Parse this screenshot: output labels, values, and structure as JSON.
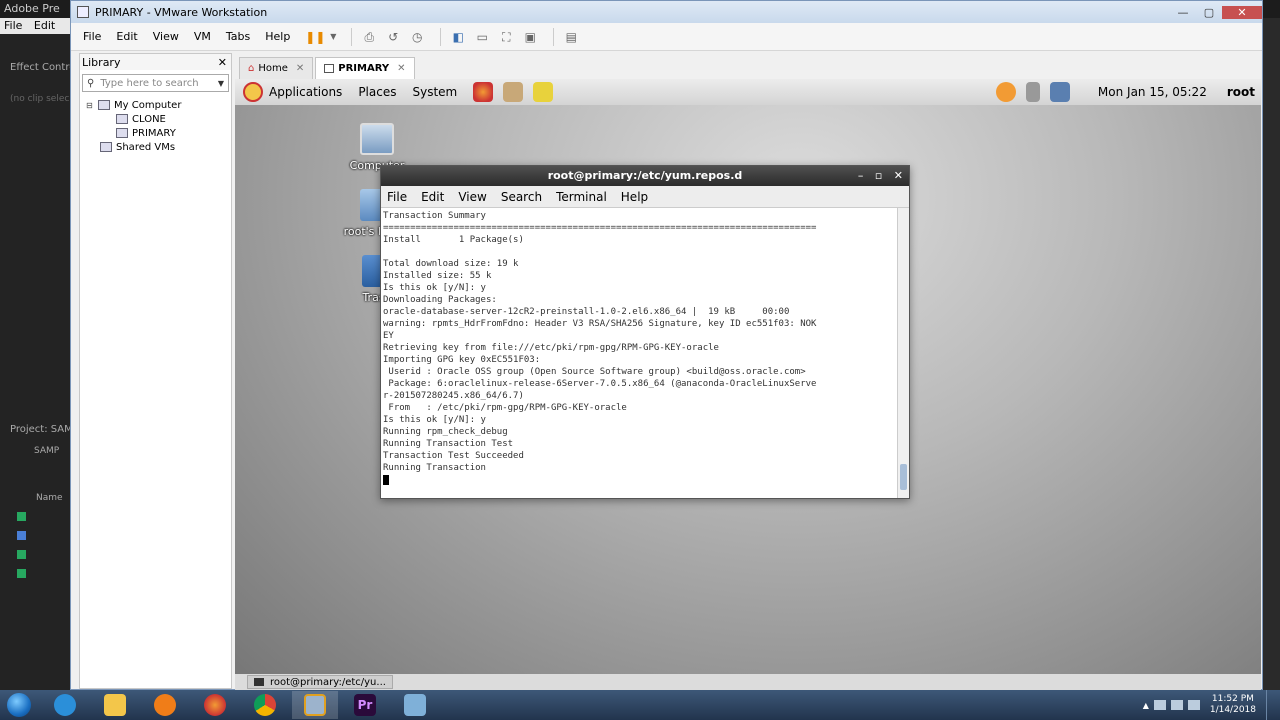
{
  "premiere": {
    "title": "Adobe Pre",
    "menu": [
      "File",
      "Edit"
    ],
    "panel_effect": "Effect Contro",
    "panel_noclip": "(no clip selec",
    "panel_project": "Project: SAM",
    "panel_sample": "SAMP",
    "panel_name": "Name",
    "swatches": [
      "#27a860",
      "#4a7fd6",
      "#27a860",
      "#27a860"
    ]
  },
  "vmware": {
    "window_title": "PRIMARY - VMware Workstation",
    "title_controls": [
      "—",
      "▢",
      "✕"
    ],
    "menu": [
      "File",
      "Edit",
      "View",
      "VM",
      "Tabs",
      "Help"
    ],
    "library_title": "Library",
    "library_close": "✕",
    "search_placeholder": "Type here to search",
    "tree": {
      "my_computer": "My Computer",
      "clone": "CLONE",
      "primary": "PRIMARY",
      "shared": "Shared VMs"
    },
    "tabs": [
      {
        "label": "Home",
        "close": "✕"
      },
      {
        "label": "PRIMARY",
        "close": "✕"
      }
    ],
    "status_task": "root@primary:/etc/yu..."
  },
  "gnome": {
    "menu": [
      "Applications",
      "Places",
      "System"
    ],
    "clock": "Mon Jan 15, 05:22",
    "user": "root",
    "desktop_icons": [
      "Computer",
      "root's Home",
      "Trash"
    ]
  },
  "terminal": {
    "title": "root@primary:/etc/yum.repos.d",
    "controls": [
      "–",
      "▫",
      "✕"
    ],
    "menu": [
      "File",
      "Edit",
      "View",
      "Search",
      "Terminal",
      "Help"
    ],
    "lines": [
      "Transaction Summary",
      "================================================================================",
      "Install       1 Package(s)",
      "",
      "Total download size: 19 k",
      "Installed size: 55 k",
      "Is this ok [y/N]: y",
      "Downloading Packages:",
      "oracle-database-server-12cR2-preinstall-1.0-2.el6.x86_64 |  19 kB     00:00",
      "warning: rpmts_HdrFromFdno: Header V3 RSA/SHA256 Signature, key ID ec551f03: NOK",
      "EY",
      "Retrieving key from file:///etc/pki/rpm-gpg/RPM-GPG-KEY-oracle",
      "Importing GPG key 0xEC551F03:",
      " Userid : Oracle OSS group (Open Source Software group) <build@oss.oracle.com>",
      " Package: 6:oraclelinux-release-6Server-7.0.5.x86_64 (@anaconda-OracleLinuxServe",
      "r-201507280245.x86_64/6.7)",
      " From   : /etc/pki/rpm-gpg/RPM-GPG-KEY-oracle",
      "Is this ok [y/N]: y",
      "Running rpm_check_debug",
      "Running Transaction Test",
      "Transaction Test Succeeded",
      "Running Transaction"
    ]
  },
  "taskbar": {
    "time": "11:52 PM",
    "date": "1/14/2018",
    "apps": [
      "file-explorer",
      "media-player",
      "firefox",
      "chrome",
      "vmware",
      "premiere",
      "misc"
    ]
  },
  "colors": {
    "firefox": "#e8731c",
    "chrome": "#3cba54",
    "premiere": "#2a0a3a",
    "explorer": "#f3c64a",
    "ie": "#2b8fd9"
  }
}
